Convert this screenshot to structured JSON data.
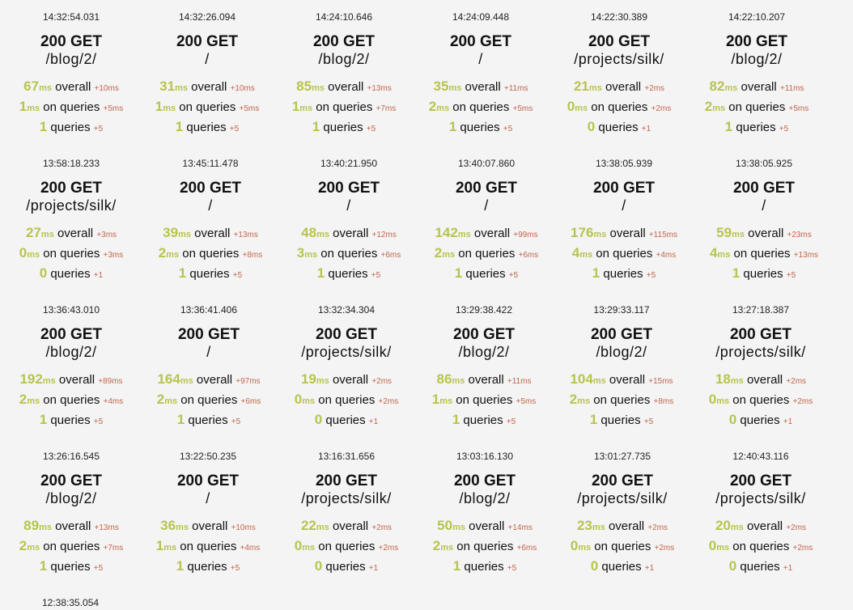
{
  "requests": [
    {
      "time": "14:32:54.031",
      "status": "200 GET",
      "path": "/blog/2/",
      "overall": "67",
      "overall_delta": "+10ms",
      "db": "1",
      "db_delta": "+5ms",
      "queries": "1",
      "queries_delta": "+5"
    },
    {
      "time": "14:32:26.094",
      "status": "200 GET",
      "path": "/",
      "overall": "31",
      "overall_delta": "+10ms",
      "db": "1",
      "db_delta": "+5ms",
      "queries": "1",
      "queries_delta": "+5"
    },
    {
      "time": "14:24:10.646",
      "status": "200 GET",
      "path": "/blog/2/",
      "overall": "85",
      "overall_delta": "+13ms",
      "db": "1",
      "db_delta": "+7ms",
      "queries": "1",
      "queries_delta": "+5"
    },
    {
      "time": "14:24:09.448",
      "status": "200 GET",
      "path": "/",
      "overall": "35",
      "overall_delta": "+11ms",
      "db": "2",
      "db_delta": "+5ms",
      "queries": "1",
      "queries_delta": "+5"
    },
    {
      "time": "14:22:30.389",
      "status": "200 GET",
      "path": "/projects/silk/",
      "overall": "21",
      "overall_delta": "+2ms",
      "db": "0",
      "db_delta": "+2ms",
      "queries": "0",
      "queries_delta": "+1"
    },
    {
      "time": "14:22:10.207",
      "status": "200 GET",
      "path": "/blog/2/",
      "overall": "82",
      "overall_delta": "+11ms",
      "db": "2",
      "db_delta": "+5ms",
      "queries": "1",
      "queries_delta": "+5"
    },
    {
      "time": "13:58:18.233",
      "status": "200 GET",
      "path": "/projects/silk/",
      "overall": "27",
      "overall_delta": "+3ms",
      "db": "0",
      "db_delta": "+3ms",
      "queries": "0",
      "queries_delta": "+1"
    },
    {
      "time": "13:45:11.478",
      "status": "200 GET",
      "path": "/",
      "overall": "39",
      "overall_delta": "+13ms",
      "db": "2",
      "db_delta": "+8ms",
      "queries": "1",
      "queries_delta": "+5"
    },
    {
      "time": "13:40:21.950",
      "status": "200 GET",
      "path": "/",
      "overall": "48",
      "overall_delta": "+12ms",
      "db": "3",
      "db_delta": "+6ms",
      "queries": "1",
      "queries_delta": "+5"
    },
    {
      "time": "13:40:07.860",
      "status": "200 GET",
      "path": "/",
      "overall": "142",
      "overall_delta": "+99ms",
      "db": "2",
      "db_delta": "+6ms",
      "queries": "1",
      "queries_delta": "+5"
    },
    {
      "time": "13:38:05.939",
      "status": "200 GET",
      "path": "/",
      "overall": "176",
      "overall_delta": "+115ms",
      "db": "4",
      "db_delta": "+4ms",
      "queries": "1",
      "queries_delta": "+5"
    },
    {
      "time": "13:38:05.925",
      "status": "200 GET",
      "path": "/",
      "overall": "59",
      "overall_delta": "+23ms",
      "db": "4",
      "db_delta": "+13ms",
      "queries": "1",
      "queries_delta": "+5"
    },
    {
      "time": "13:36:43.010",
      "status": "200 GET",
      "path": "/blog/2/",
      "overall": "192",
      "overall_delta": "+89ms",
      "db": "2",
      "db_delta": "+4ms",
      "queries": "1",
      "queries_delta": "+5"
    },
    {
      "time": "13:36:41.406",
      "status": "200 GET",
      "path": "/",
      "overall": "164",
      "overall_delta": "+97ms",
      "db": "2",
      "db_delta": "+6ms",
      "queries": "1",
      "queries_delta": "+5"
    },
    {
      "time": "13:32:34.304",
      "status": "200 GET",
      "path": "/projects/silk/",
      "overall": "19",
      "overall_delta": "+2ms",
      "db": "0",
      "db_delta": "+2ms",
      "queries": "0",
      "queries_delta": "+1"
    },
    {
      "time": "13:29:38.422",
      "status": "200 GET",
      "path": "/blog/2/",
      "overall": "86",
      "overall_delta": "+11ms",
      "db": "1",
      "db_delta": "+5ms",
      "queries": "1",
      "queries_delta": "+5"
    },
    {
      "time": "13:29:33.117",
      "status": "200 GET",
      "path": "/blog/2/",
      "overall": "104",
      "overall_delta": "+15ms",
      "db": "2",
      "db_delta": "+8ms",
      "queries": "1",
      "queries_delta": "+5"
    },
    {
      "time": "13:27:18.387",
      "status": "200 GET",
      "path": "/projects/silk/",
      "overall": "18",
      "overall_delta": "+2ms",
      "db": "0",
      "db_delta": "+2ms",
      "queries": "0",
      "queries_delta": "+1"
    },
    {
      "time": "13:26:16.545",
      "status": "200 GET",
      "path": "/blog/2/",
      "overall": "89",
      "overall_delta": "+13ms",
      "db": "2",
      "db_delta": "+7ms",
      "queries": "1",
      "queries_delta": "+5"
    },
    {
      "time": "13:22:50.235",
      "status": "200 GET",
      "path": "/",
      "overall": "36",
      "overall_delta": "+10ms",
      "db": "1",
      "db_delta": "+4ms",
      "queries": "1",
      "queries_delta": "+5"
    },
    {
      "time": "13:16:31.656",
      "status": "200 GET",
      "path": "/projects/silk/",
      "overall": "22",
      "overall_delta": "+2ms",
      "db": "0",
      "db_delta": "+2ms",
      "queries": "0",
      "queries_delta": "+1"
    },
    {
      "time": "13:03:16.130",
      "status": "200 GET",
      "path": "/blog/2/",
      "overall": "50",
      "overall_delta": "+14ms",
      "db": "2",
      "db_delta": "+6ms",
      "queries": "1",
      "queries_delta": "+5"
    },
    {
      "time": "13:01:27.735",
      "status": "200 GET",
      "path": "/projects/silk/",
      "overall": "23",
      "overall_delta": "+2ms",
      "db": "0",
      "db_delta": "+2ms",
      "queries": "0",
      "queries_delta": "+1"
    },
    {
      "time": "12:40:43.116",
      "status": "200 GET",
      "path": "/projects/silk/",
      "overall": "20",
      "overall_delta": "+2ms",
      "db": "0",
      "db_delta": "+2ms",
      "queries": "0",
      "queries_delta": "+1"
    }
  ],
  "partial_time": "12:38:35.054",
  "labels": {
    "unit_ms": "ms",
    "overall": "overall",
    "on_queries": "on queries",
    "queries": "queries"
  },
  "colors": {
    "metric": "#b7c44d",
    "delta": "#c2664d",
    "text": "#111111",
    "background": "#f4f4f4"
  }
}
